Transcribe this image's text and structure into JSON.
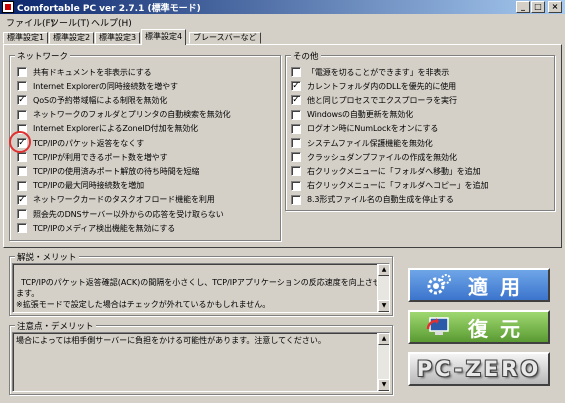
{
  "window": {
    "title": "Comfortable PC ver 2.7.1 (標準モード)"
  },
  "window_buttons": {
    "minimize": "_",
    "maximize": "□",
    "close": "×"
  },
  "menu": [
    {
      "label": "ファイル(F)"
    },
    {
      "label": "ツール(T)"
    },
    {
      "label": "ヘルプ(H)"
    }
  ],
  "tabs": [
    {
      "label": "標準設定1",
      "active": false
    },
    {
      "label": "標準設定2",
      "active": false
    },
    {
      "label": "標準設定3",
      "active": false
    },
    {
      "label": "標準設定4",
      "active": true
    },
    {
      "label": "ブレースバーなど",
      "active": false
    }
  ],
  "network": {
    "title": "ネットワーク",
    "items": [
      {
        "label": "共有ドキュメントを非表示にする",
        "checked": false
      },
      {
        "label": "Internet Explorerの同時接続数を増やす",
        "checked": false
      },
      {
        "label": "QoSの予約帯域幅による制限を無効化",
        "checked": true
      },
      {
        "label": "ネットワークのフォルダとプリンタの自動検索を無効化",
        "checked": false
      },
      {
        "label": "Internet ExplorerによるZoneID付加を無効化",
        "checked": false
      },
      {
        "label": "TCP/IPのパケット返答をなくす",
        "checked": true
      },
      {
        "label": "TCP/IPが利用できるポート数を増やす",
        "checked": false
      },
      {
        "label": "TCP/IPの使用済みポート解放の待ち時間を短縮",
        "checked": false
      },
      {
        "label": "TCP/IPの最大同時接続数を増加",
        "checked": false
      },
      {
        "label": "ネットワークカードのタスクオフロード機能を利用",
        "checked": true
      },
      {
        "label": "照会先のDNSサーバー以外からの応答を受け取らない",
        "checked": false
      },
      {
        "label": "TCP/IPのメディア検出機能を無効にする",
        "checked": false
      }
    ]
  },
  "other": {
    "title": "その他",
    "items": [
      {
        "label": "「電源を切ることができます」を非表示",
        "checked": false
      },
      {
        "label": "カレントフォルダ内のDLLを優先的に使用",
        "checked": true
      },
      {
        "label": "他と同じプロセスでエクスプローラを実行",
        "checked": true
      },
      {
        "label": "Windowsの自動更新を無効化",
        "checked": false
      },
      {
        "label": "ログオン時にNumLockをオンにする",
        "checked": false
      },
      {
        "label": "システムファイル保護機能を無効化",
        "checked": false
      },
      {
        "label": "クラッシュダンプファイルの作成を無効化",
        "checked": false
      },
      {
        "label": "右クリックメニューに「フォルダへ移動」を追加",
        "checked": false
      },
      {
        "label": "右クリックメニューに「フォルダへコピー」を追加",
        "checked": false
      },
      {
        "label": "8.3形式ファイル名の自動生成を停止する",
        "checked": false
      }
    ]
  },
  "description": {
    "title": "解説・メリット",
    "text": "TCP/IPのパケット返答確認(ACK)の間隔を小さくし、TCP/IPアプリケーションの反応速度を向上させます。\n※拡張モードで設定した場合はチェックが外れているかもしれません。"
  },
  "caution": {
    "title": "注意点・デメリット",
    "text": "場合によっては相手側サーバーに負担をかける可能性があります。注意してください。"
  },
  "buttons": {
    "apply": "適用",
    "restore": "復元",
    "pczero": "PC-ZERO"
  },
  "colors": {
    "title_bar": "#0a246a",
    "apply": "#4a86d8",
    "restore": "#6eae42",
    "highlight_circle": "#e03030"
  }
}
